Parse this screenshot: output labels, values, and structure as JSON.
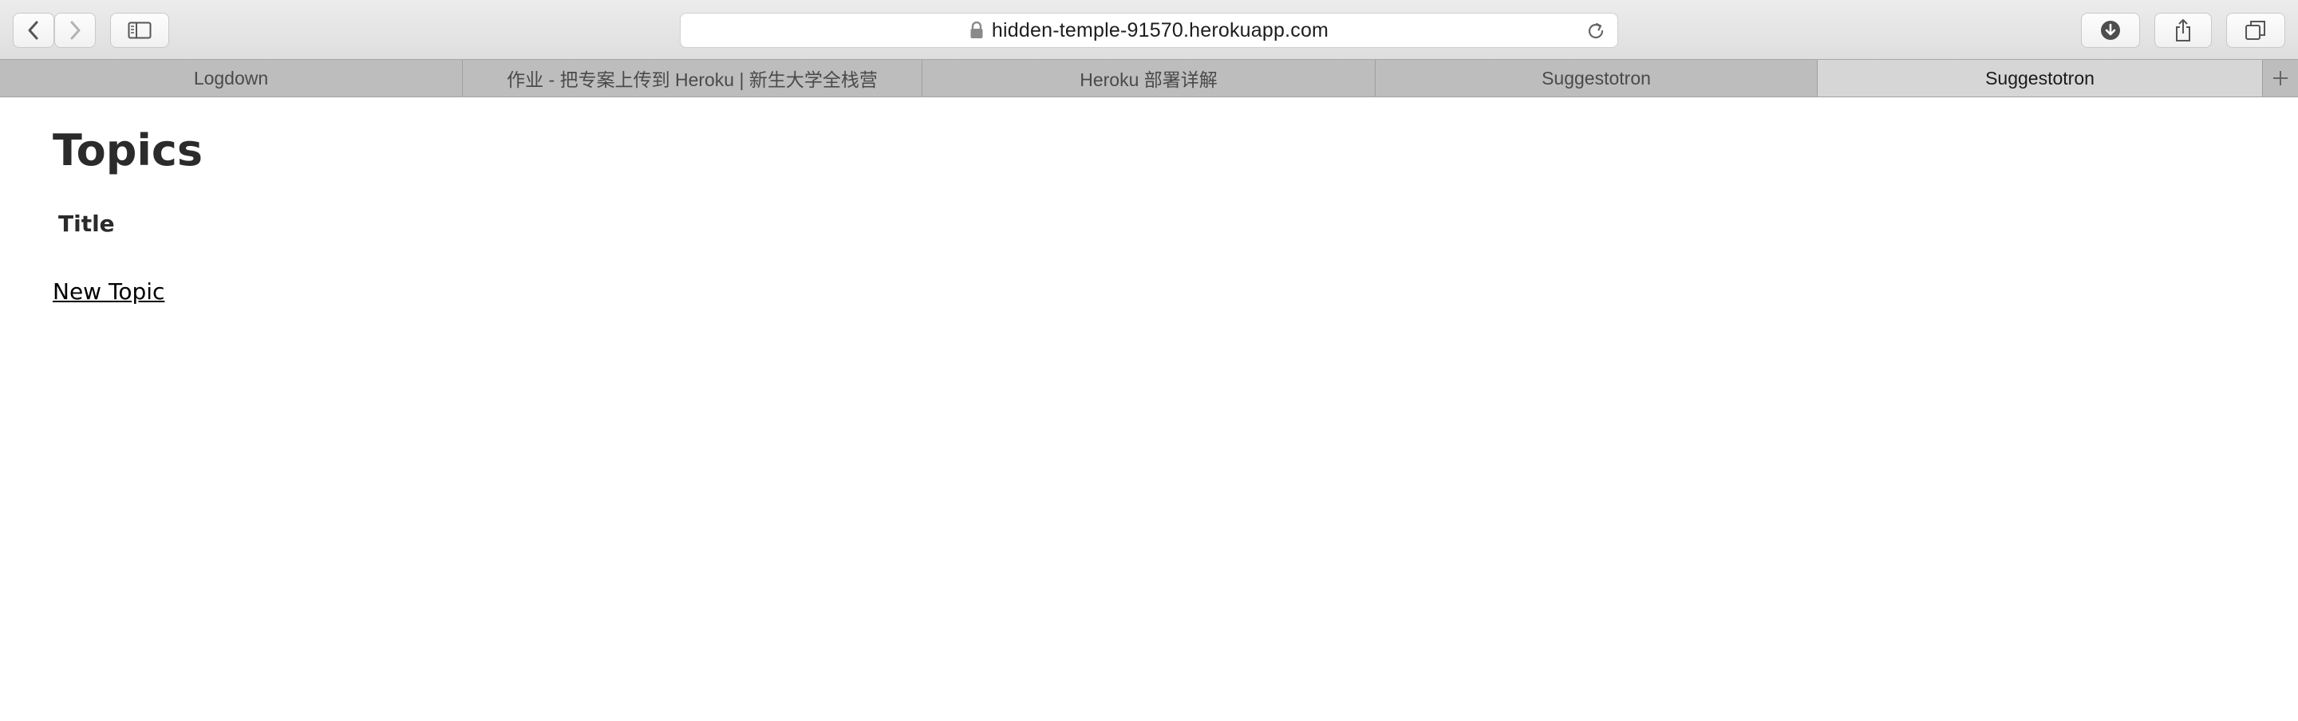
{
  "browser": {
    "url": "hidden-temple-91570.herokuapp.com",
    "icons": {
      "back": "chevron-left-icon",
      "forward": "chevron-right-icon",
      "sidebar": "sidebar-icon",
      "lock": "lock-icon",
      "reload": "reload-icon",
      "downloads": "download-icon",
      "share": "share-icon",
      "tabs": "tabs-overview-icon",
      "new_tab": "plus-icon"
    }
  },
  "tabs": [
    {
      "label": "Logdown",
      "active": false
    },
    {
      "label": "作业 - 把专案上传到 Heroku | 新生大学全栈营",
      "active": false
    },
    {
      "label": "Heroku 部署详解",
      "active": false
    },
    {
      "label": "Suggestotron",
      "active": false
    },
    {
      "label": "Suggestotron",
      "active": true
    }
  ],
  "page": {
    "heading": "Topics",
    "table": {
      "columns": [
        "Title"
      ]
    },
    "new_link": "New Topic"
  },
  "colors": {
    "toolbar_bg": "#e4e4e4",
    "tabbar_bg": "#bdbdbd",
    "active_tab_bg": "#d6d6d6",
    "text_dark": "#2b2b2b"
  }
}
